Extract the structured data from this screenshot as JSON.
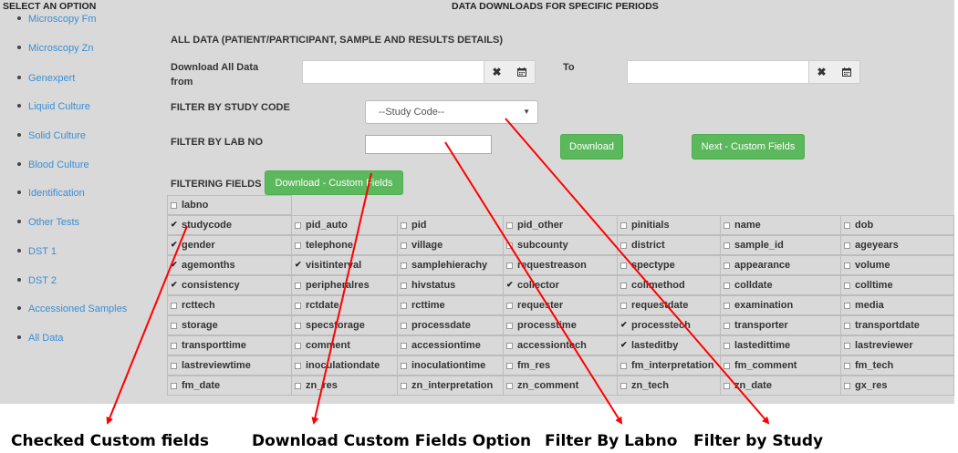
{
  "sidebar": {
    "title": "SELECT AN OPTION",
    "items": [
      {
        "label": "Microscopy Fm"
      },
      {
        "label": "Microscopy Zn"
      },
      {
        "label": "Genexpert"
      },
      {
        "label": "Liquid Culture"
      },
      {
        "label": "Solid Culture"
      },
      {
        "label": "Blood Culture"
      },
      {
        "label": "Identification"
      },
      {
        "label": "Other Tests"
      },
      {
        "label": "DST 1"
      },
      {
        "label": "DST 2"
      },
      {
        "label": "Accessioned Samples"
      },
      {
        "label": "All Data"
      }
    ]
  },
  "page": {
    "title": "DATA DOWNLOADS FOR SPECIFIC PERIODS",
    "section_title": "ALL DATA (PATIENT/PARTICIPANT, SAMPLE AND RESULTS DETAILS)"
  },
  "form": {
    "from_label_line1": "Download All Data",
    "from_label_line2": "from",
    "to_label": "To",
    "from_value": "",
    "to_value": "",
    "clear_icon": "clear-icon",
    "calendar_icon": "calendar-icon",
    "study_code_label": "FILTER BY STUDY CODE",
    "study_code_selected": "--Study Code--",
    "lab_no_label": "FILTER BY LAB NO",
    "lab_no_value": "",
    "download_button": "Download",
    "next_custom_button": "Next - Custom Fields",
    "filtering_fields_label": "FILTERING FIELDS",
    "download_custom_button": "Download - Custom Fields"
  },
  "fields": {
    "first": {
      "label": "labno",
      "checked": false
    },
    "rows": [
      [
        [
          "studycode",
          true
        ],
        [
          "pid_auto",
          false
        ],
        [
          "pid",
          false
        ],
        [
          "pid_other",
          false
        ],
        [
          "pinitials",
          false
        ],
        [
          "name",
          false
        ],
        [
          "dob",
          false
        ]
      ],
      [
        [
          "gender",
          true
        ],
        [
          "telephone",
          false
        ],
        [
          "village",
          false
        ],
        [
          "subcounty",
          false
        ],
        [
          "district",
          false
        ],
        [
          "sample_id",
          false
        ],
        [
          "ageyears",
          false
        ]
      ],
      [
        [
          "agemonths",
          true
        ],
        [
          "visitinterval",
          true
        ],
        [
          "samplehierachy",
          false
        ],
        [
          "requestreason",
          false
        ],
        [
          "spectype",
          false
        ],
        [
          "appearance",
          false
        ],
        [
          "volume",
          false
        ]
      ],
      [
        [
          "consistency",
          true
        ],
        [
          "peripheralres",
          false
        ],
        [
          "hivstatus",
          false
        ],
        [
          "collector",
          true
        ],
        [
          "collmethod",
          false
        ],
        [
          "colldate",
          false
        ],
        [
          "colltime",
          false
        ]
      ],
      [
        [
          "rcttech",
          false
        ],
        [
          "rctdate",
          false
        ],
        [
          "rcttime",
          false
        ],
        [
          "requester",
          false
        ],
        [
          "requestdate",
          false
        ],
        [
          "examination",
          false
        ],
        [
          "media",
          false
        ]
      ],
      [
        [
          "storage",
          false
        ],
        [
          "specstorage",
          false
        ],
        [
          "processdate",
          false
        ],
        [
          "processtime",
          false
        ],
        [
          "processtech",
          true
        ],
        [
          "transporter",
          false
        ],
        [
          "transportdate",
          false
        ]
      ],
      [
        [
          "transporttime",
          false
        ],
        [
          "comment",
          false
        ],
        [
          "accessiontime",
          false
        ],
        [
          "accessiontech",
          false
        ],
        [
          "lasteditby",
          true
        ],
        [
          "lastedittime",
          false
        ],
        [
          "lastreviewer",
          false
        ]
      ],
      [
        [
          "lastreviewtime",
          false
        ],
        [
          "inoculationdate",
          false
        ],
        [
          "inoculationtime",
          false
        ],
        [
          "fm_res",
          false
        ],
        [
          "fm_interpretation",
          false
        ],
        [
          "fm_comment",
          false
        ],
        [
          "fm_tech",
          false
        ]
      ],
      [
        [
          "fm_date",
          false
        ],
        [
          "zn_res",
          false
        ],
        [
          "zn_interpretation",
          false
        ],
        [
          "zn_comment",
          false
        ],
        [
          "zn_tech",
          false
        ],
        [
          "zn_date",
          false
        ],
        [
          "gx_res",
          false
        ]
      ]
    ]
  },
  "annotations": {
    "checked_custom": "Checked Custom fields",
    "download_custom": "Download Custom Fields Option",
    "filter_labno": "Filter By Labno",
    "filter_study": "Filter by Study",
    "arrow_color": "#ff0000"
  },
  "colors": {
    "background": "#d9d9d9",
    "link": "#3b8ed4",
    "button_green": "#5cb85c"
  }
}
